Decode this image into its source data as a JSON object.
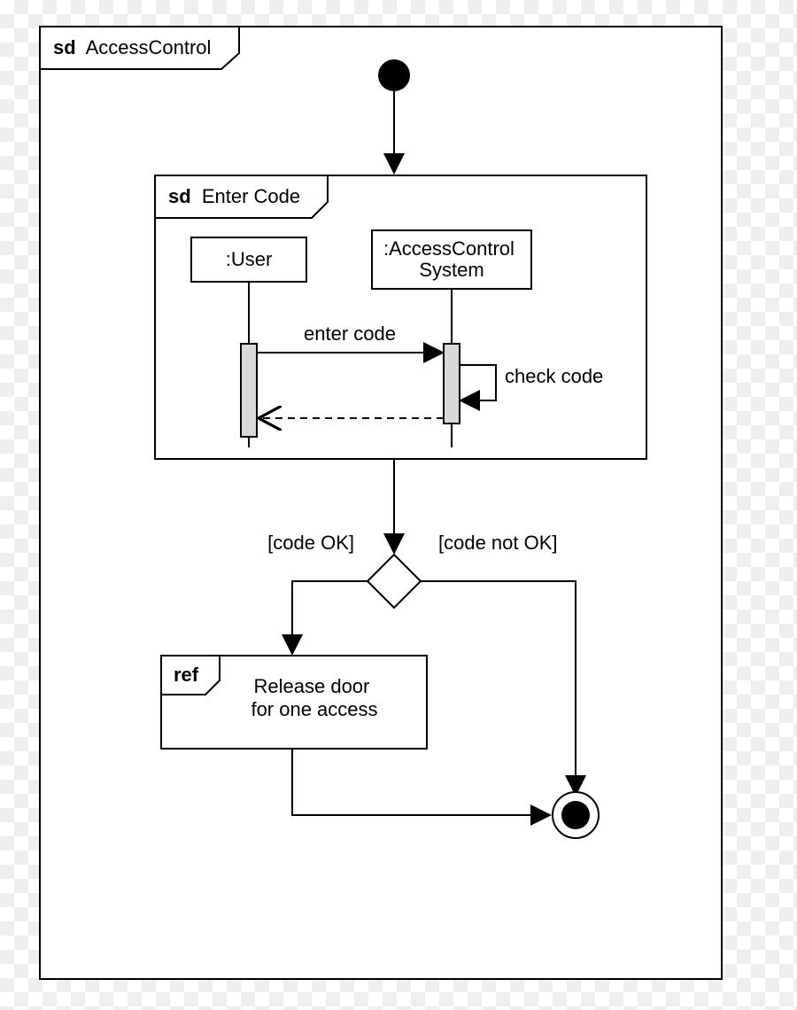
{
  "diagram": {
    "outer_frame_tag": "sd",
    "outer_frame_title": "AccessControl",
    "inner_frame_tag": "sd",
    "inner_frame_title": "Enter Code",
    "lifeline_user": ":User",
    "lifeline_system_line1": ":AccessControl",
    "lifeline_system_line2": "System",
    "msg_enter_code": "enter code",
    "msg_check_code": "check code",
    "guard_ok": "[code OK]",
    "guard_not_ok": "[code not OK]",
    "ref_tag": "ref",
    "ref_line1": "Release door",
    "ref_line2": "for one access"
  }
}
